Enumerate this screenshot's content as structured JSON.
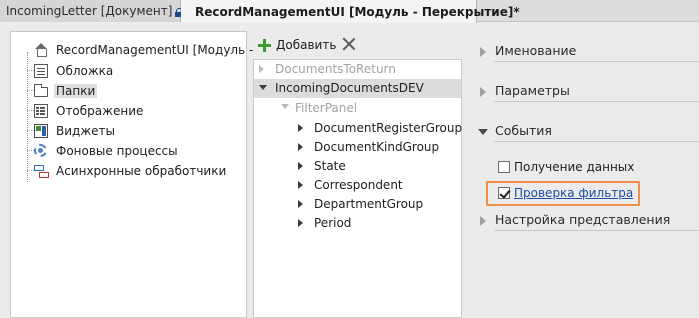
{
  "tabs": [
    {
      "label": "IncomingLetter [Документ]",
      "locked": true,
      "active": false
    },
    {
      "label": "RecordManagementUI [Модуль - Перекрытие]*",
      "active": true
    }
  ],
  "left_tree": {
    "root": "RecordManagementUI [Модуль -",
    "items": [
      {
        "label": "Обложка",
        "icon": "cover-icon"
      },
      {
        "label": "Папки",
        "icon": "folder-icon",
        "selected": true
      },
      {
        "label": "Отображение",
        "icon": "display-icon"
      },
      {
        "label": "Виджеты",
        "icon": "widgets-icon"
      },
      {
        "label": "Фоновые процессы",
        "icon": "gear-icon"
      },
      {
        "label": "Асинхронные обработчики",
        "icon": "async-handler-icon"
      }
    ]
  },
  "toolbar": {
    "add_label": "Добавить",
    "delete_icon": "close-icon"
  },
  "folders": {
    "items": [
      {
        "label": "DocumentsToReturn",
        "muted": true
      },
      {
        "label": "IncomingDocumentsDEV",
        "selected": true
      },
      {
        "label": "FilterPanel",
        "muted": true
      },
      {
        "label": "DocumentRegisterGroup"
      },
      {
        "label": "DocumentKindGroup"
      },
      {
        "label": "State"
      },
      {
        "label": "Correspondent"
      },
      {
        "label": "DepartmentGroup"
      },
      {
        "label": "Period"
      }
    ]
  },
  "properties": {
    "sections": [
      {
        "label": "Именование",
        "expanded": false
      },
      {
        "label": "Параметры",
        "expanded": false
      },
      {
        "label": "События",
        "expanded": true
      },
      {
        "label": "Настройка представления",
        "expanded": false
      }
    ],
    "events": [
      {
        "label": "Получение данных",
        "checked": false
      },
      {
        "label": "Проверка фильтра",
        "checked": true,
        "highlighted": true
      }
    ]
  },
  "colors": {
    "accent_highlight": "#ef8d4c",
    "link": "#1f4ea8",
    "add_green": "#3a9a2e"
  }
}
